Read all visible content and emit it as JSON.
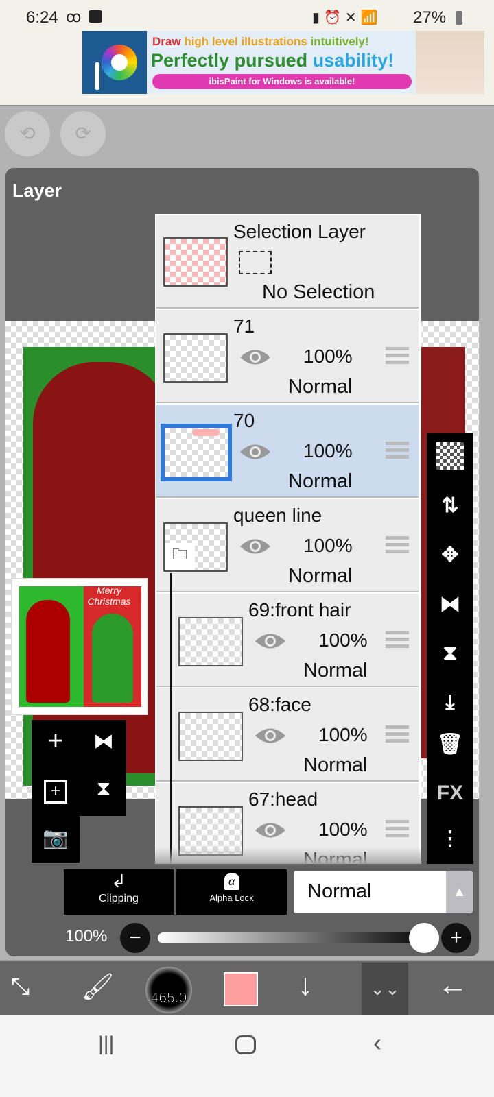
{
  "status_bar": {
    "time": "6:24",
    "battery": "27%"
  },
  "ad": {
    "line1_a": "Draw",
    "line1_b": "high level illustrations",
    "line1_c": "intuitively!",
    "line2_a": "Perfectly pursued",
    "line2_b": "usability!",
    "pill": "ibisPaint for Windows is available!"
  },
  "panel": {
    "title": "Layer"
  },
  "selection_layer": {
    "name": "Selection Layer",
    "status": "No Selection"
  },
  "layers": [
    {
      "name": "71",
      "opacity": "100%",
      "mode": "Normal"
    },
    {
      "name": "70",
      "opacity": "100%",
      "mode": "Normal",
      "selected": true
    },
    {
      "name": "queen line",
      "opacity": "100%",
      "mode": "Normal",
      "folder": true
    },
    {
      "name": "69:front hair",
      "opacity": "100%",
      "mode": "Normal"
    },
    {
      "name": "68:face",
      "opacity": "100%",
      "mode": "Normal"
    },
    {
      "name": "67:head",
      "opacity": "100%",
      "mode": "Normal"
    }
  ],
  "preview_text": "Merry Christmas",
  "right_toolbar": {
    "fx": "FX"
  },
  "bottom": {
    "clipping": "Clipping",
    "alpha_lock": "Alpha Lock",
    "blend_mode": "Normal",
    "opacity": "100%",
    "opacity_value": 1.0
  },
  "toolbar": {
    "brush_size": "465.0",
    "color": "#ff9e9e"
  },
  "colors": {
    "selected_row": "#cddbee",
    "accent": "#2f7ad8"
  }
}
